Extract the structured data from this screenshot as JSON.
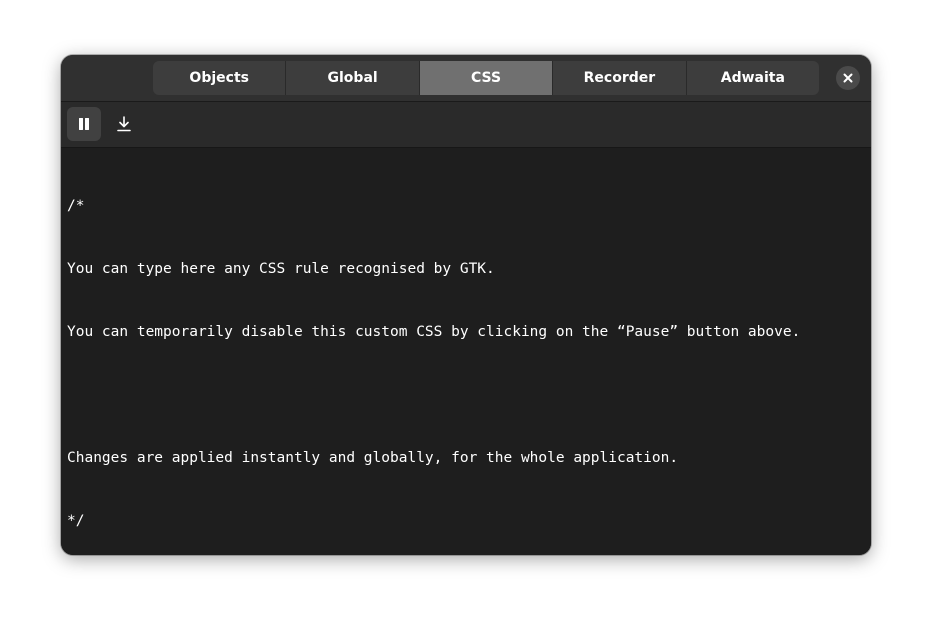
{
  "tabs": [
    {
      "label": "Objects",
      "active": false
    },
    {
      "label": "Global",
      "active": false
    },
    {
      "label": "CSS",
      "active": true
    },
    {
      "label": "Recorder",
      "active": false
    },
    {
      "label": "Adwaita",
      "active": false
    }
  ],
  "toolbar": {
    "pause_icon": "pause-icon",
    "save_icon": "download-icon"
  },
  "editor": {
    "lines": [
      "/*",
      "You can type here any CSS rule recognised by GTK.",
      "You can temporarily disable this custom CSS by clicking on the “Pause” button above.",
      "",
      "Changes are applied instantly and globally, for the whole application.",
      "*/"
    ]
  },
  "colors": {
    "window_bg": "#1e1e1e",
    "headerbar_bg": "#303030",
    "active_tab": "#707070",
    "text": "#ffffff"
  }
}
